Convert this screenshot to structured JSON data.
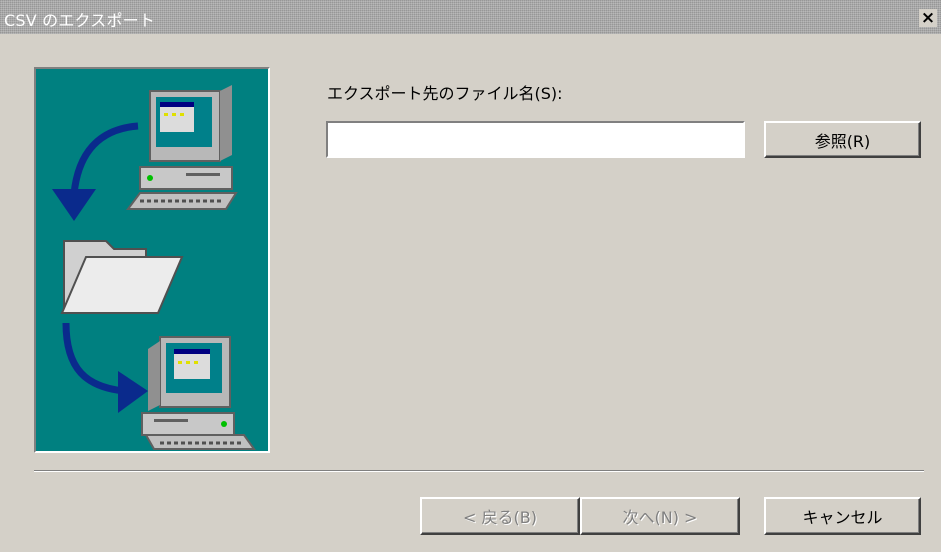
{
  "window": {
    "title": "CSV のエクスポート",
    "close_label": "×"
  },
  "main": {
    "file_label": "エクスポート先のファイル名(S):",
    "filename_value": "",
    "browse_label": "参照(R)"
  },
  "footer": {
    "back_label": "< 戻る(B)",
    "next_label": "次へ(N) >",
    "cancel_label": "キャンセル"
  },
  "colors": {
    "dialog_bg": "#d4d0c8",
    "panel_bg": "#008080",
    "arrow": "#0a2a8c"
  }
}
